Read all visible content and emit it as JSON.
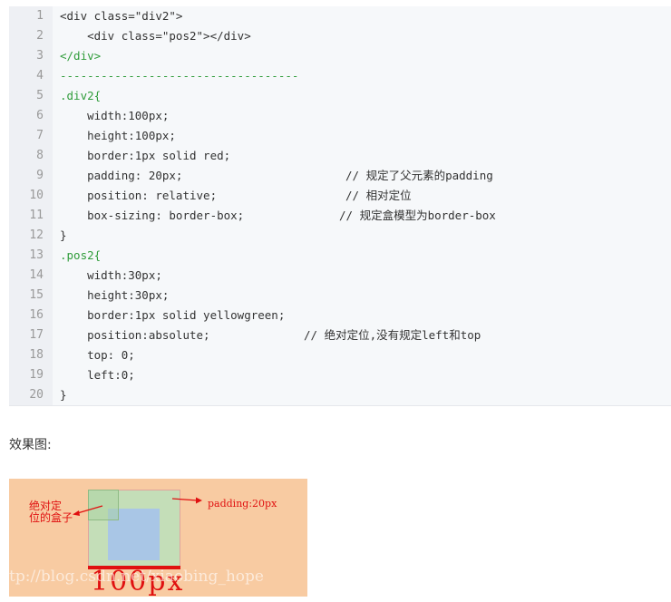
{
  "code_lines": [
    {
      "num": "1",
      "text": "<div class=\"div2\">",
      "comment": ""
    },
    {
      "num": "2",
      "text": "    <div class=\"pos2\"></div>",
      "comment": ""
    },
    {
      "num": "3",
      "text": "</div>",
      "comment": ""
    },
    {
      "num": "4",
      "text": "-----------------------------------",
      "comment": ""
    },
    {
      "num": "5",
      "text": ".div2{",
      "comment": ""
    },
    {
      "num": "6",
      "text": "    width:100px;",
      "comment": ""
    },
    {
      "num": "7",
      "text": "    height:100px;",
      "comment": ""
    },
    {
      "num": "8",
      "text": "    border:1px solid red;",
      "comment": ""
    },
    {
      "num": "9",
      "text": "    padding: 20px;",
      "comment": "// 规定了父元素的padding"
    },
    {
      "num": "10",
      "text": "    position: relative;",
      "comment": "// 相对定位"
    },
    {
      "num": "11",
      "text": "    box-sizing: border-box;",
      "comment": "// 规定盒模型为border-box"
    },
    {
      "num": "12",
      "text": "}",
      "comment": ""
    },
    {
      "num": "13",
      "text": ".pos2{",
      "comment": ""
    },
    {
      "num": "14",
      "text": "    width:30px;",
      "comment": ""
    },
    {
      "num": "15",
      "text": "    height:30px;",
      "comment": ""
    },
    {
      "num": "16",
      "text": "    border:1px solid yellowgreen;",
      "comment": ""
    },
    {
      "num": "17",
      "text": "    position:absolute;",
      "comment": "// 绝对定位,没有规定left和top"
    },
    {
      "num": "18",
      "text": "    top: 0;",
      "comment": ""
    },
    {
      "num": "19",
      "text": "    left:0;",
      "comment": ""
    },
    {
      "num": "20",
      "text": "}",
      "comment": ""
    }
  ],
  "caption": "效果图:",
  "demo": {
    "label_box_line1": "绝对定",
    "label_box_line2": "位的盒子",
    "label_padding": "padding:20px",
    "handwritten": "100px",
    "watermark": "tp://blog.csdn.net/xiaobing_hope"
  }
}
